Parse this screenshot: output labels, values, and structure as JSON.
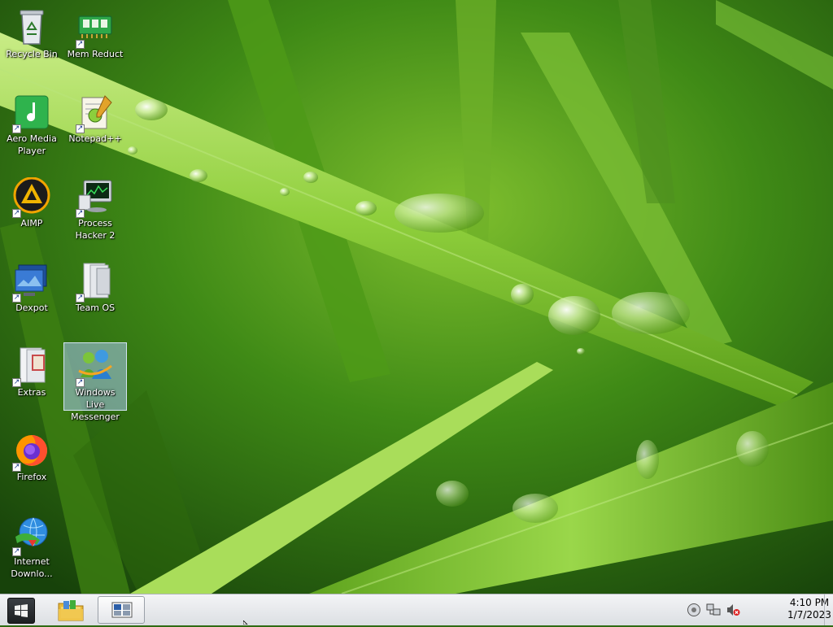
{
  "desktop": {
    "icons": [
      {
        "name": "recycle-bin",
        "label": "Recycle Bin",
        "icon": "recycle-bin-icon",
        "shortcut": false
      },
      {
        "name": "mem-reduct",
        "label": "Mem Reduct",
        "icon": "memory-chip-icon",
        "shortcut": true
      },
      {
        "name": "aero-media-player",
        "label": "Aero Media Player",
        "icon": "music-note-icon",
        "shortcut": true
      },
      {
        "name": "notepad-plus-plus",
        "label": "Notepad++",
        "icon": "notepad-icon",
        "shortcut": true
      },
      {
        "name": "aimp",
        "label": "AIMP",
        "icon": "aimp-triangle-icon",
        "shortcut": true
      },
      {
        "name": "process-hacker",
        "label": "Process Hacker 2",
        "icon": "monitor-graph-icon",
        "shortcut": true
      },
      {
        "name": "dexpot",
        "label": "Dexpot",
        "icon": "virtual-desktop-icon",
        "shortcut": true
      },
      {
        "name": "team-os",
        "label": "Team OS",
        "icon": "folder-icon",
        "shortcut": true
      },
      {
        "name": "extras",
        "label": "Extras",
        "icon": "folder-icon",
        "shortcut": true
      },
      {
        "name": "windows-live-messenger",
        "label": "Windows Live Messenger",
        "icon": "messenger-buddies-icon",
        "shortcut": true,
        "selected": true
      },
      {
        "name": "firefox",
        "label": "Firefox",
        "icon": "firefox-icon",
        "shortcut": true
      },
      {
        "name": "internet-download-manager",
        "label": "Internet Downlo...",
        "icon": "globe-download-icon",
        "shortcut": true
      }
    ]
  },
  "taskbar": {
    "start_icon": "windows-logo-icon",
    "pinned": [
      {
        "name": "windows-explorer",
        "icon": "folder-library-icon"
      },
      {
        "name": "dexpot-desktops",
        "icon": "desktops-icon",
        "active": true
      }
    ],
    "tray": {
      "icons": [
        "disc-icon",
        "network-icon",
        "volume-muted-icon"
      ],
      "time": "4:10 PM",
      "date": "1/7/2023"
    }
  }
}
